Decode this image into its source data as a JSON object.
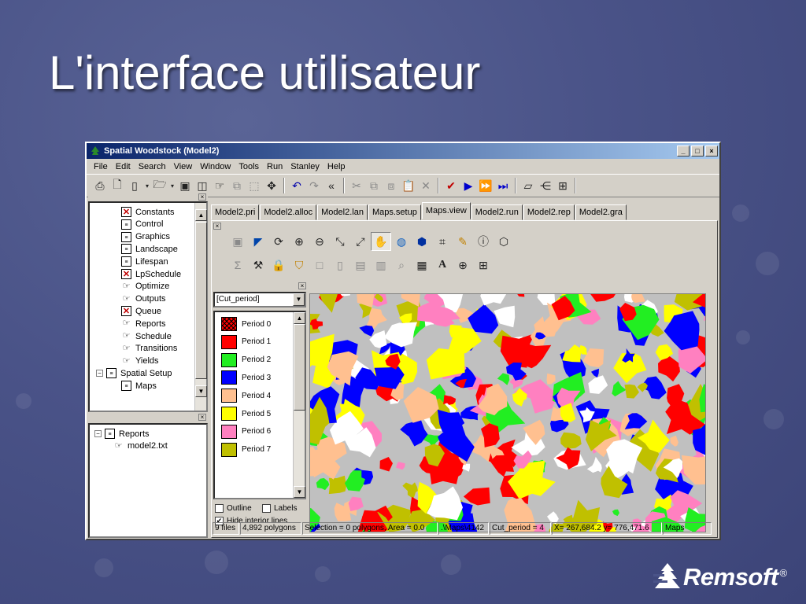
{
  "slide": {
    "title": "L'interface utilisateur",
    "logo_text": "Remsoft",
    "logo_mark": "®"
  },
  "window": {
    "title": "Spatial Woodstock (Model2)",
    "controls": {
      "minimize": "_",
      "maximize": "□",
      "close": "×"
    }
  },
  "menu": [
    "File",
    "Edit",
    "Search",
    "View",
    "Window",
    "Tools",
    "Run",
    "Stanley",
    "Help"
  ],
  "tree_top": {
    "items": [
      {
        "label": "Constants",
        "icon": "error-doc-icon"
      },
      {
        "label": "Control",
        "icon": "document-icon"
      },
      {
        "label": "Graphics",
        "icon": "document-icon"
      },
      {
        "label": "Landscape",
        "icon": "document-icon"
      },
      {
        "label": "Lifespan",
        "icon": "document-icon"
      },
      {
        "label": "LpSchedule",
        "icon": "error-doc-icon"
      },
      {
        "label": "Optimize",
        "icon": "link-icon"
      },
      {
        "label": "Outputs",
        "icon": "link-icon"
      },
      {
        "label": "Queue",
        "icon": "error-doc-icon"
      },
      {
        "label": "Reports",
        "icon": "link-icon"
      },
      {
        "label": "Schedule",
        "icon": "link-icon"
      },
      {
        "label": "Transitions",
        "icon": "link-icon"
      },
      {
        "label": "Yields",
        "icon": "link-icon"
      },
      {
        "label": "Spatial Setup",
        "icon": "document-icon"
      },
      {
        "label": "Maps",
        "icon": "document-icon"
      }
    ]
  },
  "tree_bottom": {
    "items": [
      {
        "label": "Reports",
        "icon": "document-icon"
      },
      {
        "label": "model2.txt",
        "icon": "link-icon"
      }
    ]
  },
  "tabs": [
    "Model2.pri",
    "Model2.alloc",
    "Model2.lan",
    "Maps.setup",
    "Maps.view",
    "Model2.run",
    "Model2.rep",
    "Model2.gra"
  ],
  "active_tab": "Maps.view",
  "theme_combo": {
    "value": "[Cut_period]"
  },
  "legend": [
    {
      "label": "Period 0",
      "color": "#ff0000"
    },
    {
      "label": "Period 1",
      "color": "#ff0000"
    },
    {
      "label": "Period 2",
      "color": "#22ee22"
    },
    {
      "label": "Period 3",
      "color": "#0000ff"
    },
    {
      "label": "Period 4",
      "color": "#ffc090"
    },
    {
      "label": "Period 5",
      "color": "#ffff00"
    },
    {
      "label": "Period 6",
      "color": "#ff80c0"
    },
    {
      "label": "Period 7",
      "color": "#c0c000"
    }
  ],
  "options": {
    "outline": "Outline",
    "labels": "Labels",
    "hide_interior": "Hide interior lines",
    "outline_checked": false,
    "labels_checked": false,
    "hide_interior_checked": true
  },
  "status": [
    "9 files",
    "4,892 polygons",
    "Selection = 0 polygons, Area = 0.0",
    ".\\Maps\\4142",
    "Cut_period = 4",
    "X= 267,684.2 y= 776,471.6",
    "Maps"
  ],
  "map_colors": {
    "background": "#c0c0c0",
    "palette": [
      "#ff0000",
      "#22ee22",
      "#0000ff",
      "#ffc090",
      "#ffff00",
      "#ff80c0",
      "#c0c000",
      "#ffffff"
    ]
  }
}
